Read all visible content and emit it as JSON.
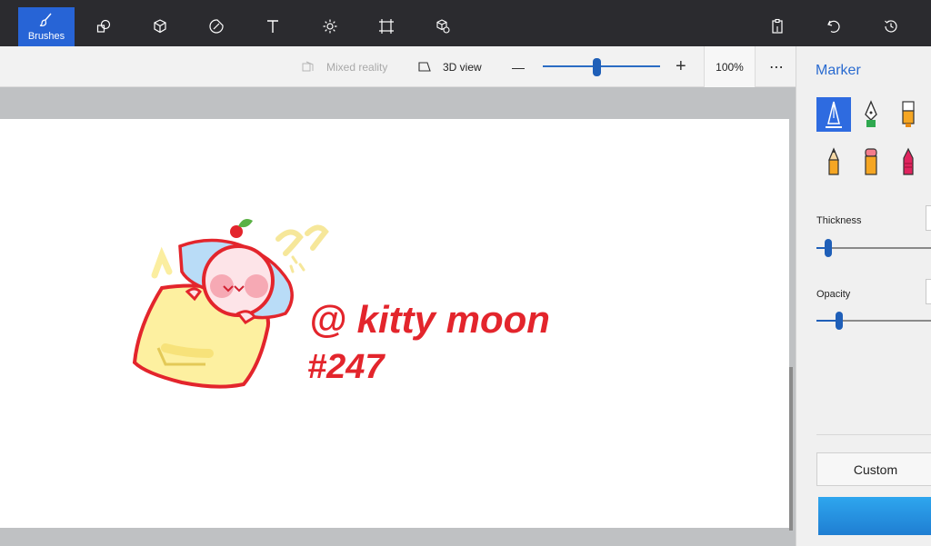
{
  "toolbar": {
    "active_label": "Brushes",
    "tools": [
      "brushes-icon",
      "2d-shapes-icon",
      "3d-shapes-icon",
      "stickers-icon",
      "text-icon",
      "effects-icon",
      "canvas-icon",
      "3d-library-icon"
    ],
    "right_tools": [
      "paste-icon",
      "undo-icon",
      "history-icon"
    ]
  },
  "subbar": {
    "mixed_reality": "Mixed reality",
    "view_3d": "3D view",
    "zoom_out": "—",
    "zoom_in": "+",
    "zoom": "100%",
    "more": "⋯",
    "zoom_slider_fraction": 0.46
  },
  "canvas": {
    "signature_line1": "@ kitty moon",
    "signature_line2": "#247"
  },
  "panel": {
    "title": "Marker",
    "brushes": [
      "marker-icon",
      "calligraphy-pen-icon",
      "oil-brush-icon",
      "pencil-icon",
      "eraser-icon",
      "crayon-icon"
    ],
    "thickness_label": "Thickness",
    "thickness_fraction": 0.1,
    "opacity_label": "Opacity",
    "opacity_fraction": 0.2,
    "custom_label": "Custom",
    "color": "#2ea6ee"
  },
  "colors": {
    "accent": "#2764d6",
    "toolbar_bg": "#2b2b2f",
    "panel_title": "#2a6bd0"
  }
}
